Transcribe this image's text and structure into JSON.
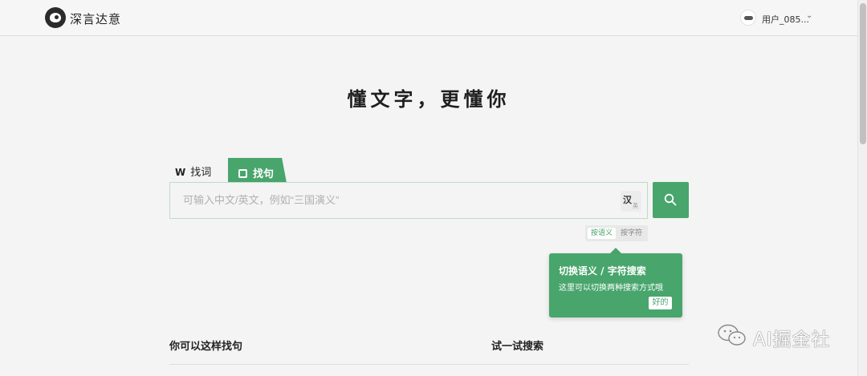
{
  "header": {
    "brand": "深言达意",
    "username": "用户_085...",
    "caret": "⌄"
  },
  "hero": {
    "title": "懂文字，更懂你"
  },
  "tabs": {
    "word": {
      "icon": "W",
      "label": "找词"
    },
    "sentence": {
      "label": "找句"
    }
  },
  "search": {
    "value": "",
    "placeholder": "可输入中文/英文，例如“三国演义”",
    "lang_main": "汉",
    "lang_sub": "英"
  },
  "mode_switch": {
    "active": "按语义",
    "inactive": "按字符"
  },
  "tooltip": {
    "title": "切换语义 / 字符搜索",
    "text": "这里可以切换两种搜索方式哦",
    "ok": "好的"
  },
  "sections": {
    "left": "你可以这样找句",
    "right": "试一试搜索"
  },
  "watermark": {
    "text": "AI掘金社"
  },
  "colors": {
    "accent": "#48a56c",
    "background": "#f4f4f4"
  },
  "icons": {
    "logo": "logo-icon",
    "avatar": "avatar-icon",
    "search": "search-icon",
    "wechat": "wechat-icon"
  }
}
